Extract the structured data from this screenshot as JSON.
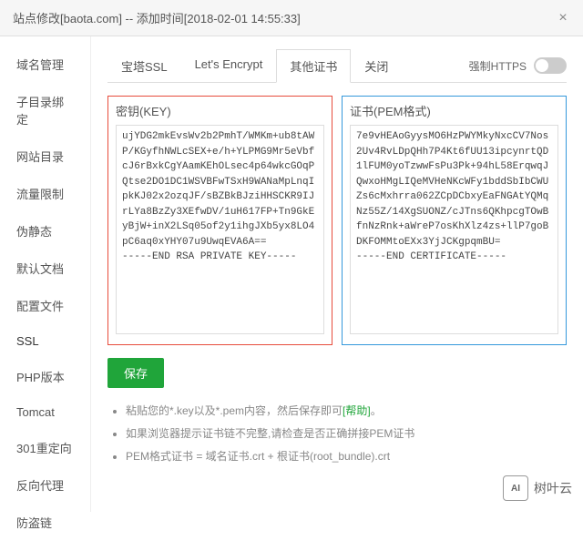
{
  "title": "站点修改[baota.com] -- 添加时间[2018-02-01 14:55:33]",
  "sidebar": {
    "items": [
      {
        "label": "域名管理"
      },
      {
        "label": "子目录绑定"
      },
      {
        "label": "网站目录"
      },
      {
        "label": "流量限制"
      },
      {
        "label": "伪静态"
      },
      {
        "label": "默认文档"
      },
      {
        "label": "配置文件"
      },
      {
        "label": "SSL"
      },
      {
        "label": "PHP版本"
      },
      {
        "label": "Tomcat"
      },
      {
        "label": "301重定向"
      },
      {
        "label": "反向代理"
      },
      {
        "label": "防盗链"
      }
    ]
  },
  "tabs": {
    "items": [
      {
        "label": "宝塔SSL"
      },
      {
        "label": "Let's Encrypt"
      },
      {
        "label": "其他证书"
      },
      {
        "label": "关闭"
      }
    ]
  },
  "https_label": "强制HTTPS",
  "key_label": "密钥(KEY)",
  "pem_label": "证书(PEM格式)",
  "key_content": "ujYDG2mkEvsWv2b2PmhT/WMKm+ub8tAWP/KGyfhNWLcSEX+e/h+YLPMG9Mr5eVbf\ncJ6rBxkCgYAamKEhOLsec4p64wkcGOqPQtse2DO1DC1WSVBFwTSxH9WANaMpLnqI\npkKJ02x2ozqJF/sBZBkBJziHHSCKR9IJrLYa8BzZy3XEfwDV/1uH617FP+Tn9GkE\nyBjW+inX2LSq05of2y1ihgJXb5yx8LO4pC6aq0xYHY07u9UwqEVA6A==\n-----END RSA PRIVATE KEY-----",
  "pem_content": "7e9vHEAoGyysMO6HzPWYMkyNxcCV7Nos2Uv4RvLDpQHh7P4Kt6fUU13ipcynrtQD\n1lFUM0yoTzwwFsPu3Pk+94hL58ErqwqJQwxoHMgLIQeMVHeNKcWFy1bddSbIbCWU\nZs6cMxhrra062ZCpDCbxyEaFNGAtYQMqNz55Z/14XgSUONZ/cJTns6QKhpcgTOwB\nfnNzRnk+aWreP7osKhXlz4zs+llP7goBDKFOMMtoEXx3YjJCKgpqmBU=\n-----END CERTIFICATE-----",
  "save_label": "保存",
  "tips": {
    "t1_a": "粘贴您的*.key以及*.pem内容，然后保存即可",
    "t1_help": "[帮助]",
    "t1_b": "。",
    "t2": "如果浏览器提示证书链不完整,请检查是否正确拼接PEM证书",
    "t3": "PEM格式证书 = 域名证书.crt + 根证书(root_bundle).crt"
  },
  "watermark": {
    "icon": "AI",
    "text": "树叶云"
  }
}
